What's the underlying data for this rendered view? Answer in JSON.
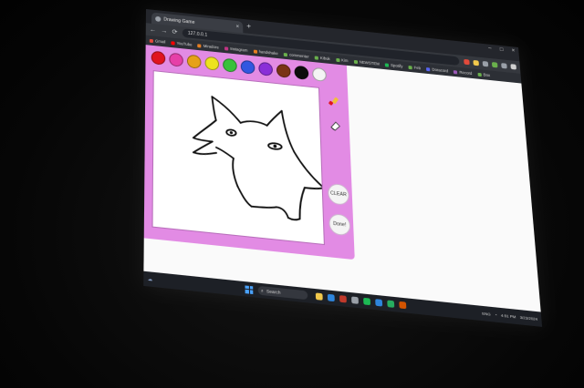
{
  "browser": {
    "tab_title": "Drawing Game",
    "tab_close": "×",
    "new_tab": "+",
    "url": "127.0.0.1",
    "window_controls": [
      "–",
      "□",
      "×"
    ],
    "nav": {
      "back": "←",
      "forward": "→",
      "reload": "⟳"
    },
    "extension_colors": [
      "#e24a3b",
      "#f2c94c",
      "#9aa0a8",
      "#6ab04c",
      "#9aa0a8",
      "#d0d0d0"
    ],
    "bookmarks": [
      {
        "label": "Gmail",
        "color": "#e24a3b"
      },
      {
        "label": "YouTube",
        "color": "#ff0000"
      },
      {
        "label": "Miradore",
        "color": "#e67e22"
      },
      {
        "label": "Instagram",
        "color": "#c13584"
      },
      {
        "label": "handshake",
        "color": "#e67e22"
      },
      {
        "label": "commenter",
        "color": "#6ab04c"
      },
      {
        "label": "Kibuk",
        "color": "#6ab04c"
      },
      {
        "label": "Kim",
        "color": "#6ab04c"
      },
      {
        "label": "NEWSTEM",
        "color": "#6ab04c"
      },
      {
        "label": "Spotify",
        "color": "#1db954"
      },
      {
        "label": "Feb",
        "color": "#6ab04c"
      },
      {
        "label": "Doracord",
        "color": "#5865f2"
      },
      {
        "label": "Record",
        "color": "#9b59b6"
      },
      {
        "label": "Box",
        "color": "#6ab04c"
      }
    ]
  },
  "drawing_app": {
    "background_color": "#e28be4",
    "palette": [
      {
        "name": "red",
        "color": "#e0141e"
      },
      {
        "name": "pink",
        "color": "#e63fa8"
      },
      {
        "name": "orange",
        "color": "#e6a118"
      },
      {
        "name": "yellow",
        "color": "#ede21e"
      },
      {
        "name": "green",
        "color": "#38c13b"
      },
      {
        "name": "blue",
        "color": "#3157e0"
      },
      {
        "name": "purple",
        "color": "#8a2fd8"
      },
      {
        "name": "brown",
        "color": "#7a3316"
      },
      {
        "name": "black",
        "color": "#0c0c0c"
      },
      {
        "name": "white",
        "color": "#f4f4f4"
      }
    ],
    "tools": [
      {
        "name": "brush",
        "icon": "brush-icon"
      },
      {
        "name": "eraser",
        "icon": "eraser-icon"
      }
    ],
    "clear_label": "CLEAR",
    "done_label": "Done!"
  },
  "taskbar": {
    "search_placeholder": "Search",
    "app_icon_colors": [
      "#f2c94c",
      "#2e86de",
      "#c0392b",
      "#9aa0a8",
      "#1db954",
      "#2e86de",
      "#27ae60",
      "#d35400"
    ],
    "time": "4:51 PM",
    "date": "3/23/2024",
    "language": "ENG"
  }
}
